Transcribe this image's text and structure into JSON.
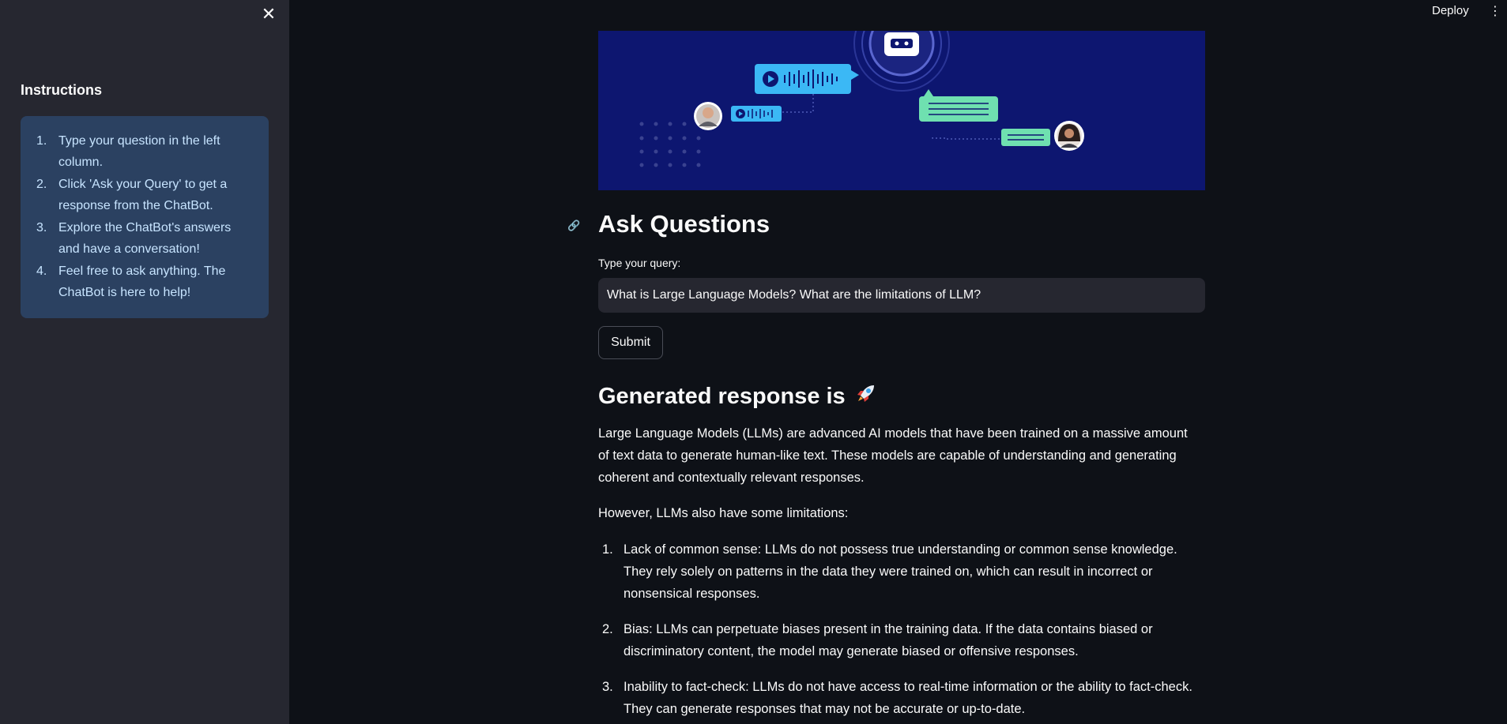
{
  "header": {
    "deploy_label": "Deploy"
  },
  "sidebar": {
    "title": "Instructions",
    "items": [
      {
        "num": "1.",
        "text": "Type your question in the left column."
      },
      {
        "num": "2.",
        "text": "Click 'Ask your Query' to get a response from the ChatBot."
      },
      {
        "num": "3.",
        "text": "Explore the ChatBot's answers and have a conversation!"
      },
      {
        "num": "4.",
        "text": "Feel free to ask anything. The ChatBot is here to help!"
      }
    ]
  },
  "main": {
    "ask_heading": "Ask Questions",
    "query_label": "Type your query:",
    "query_value": "What is Large Language Models? What are the limitations of LLM?",
    "submit_label": "Submit",
    "response_heading": "Generated response is",
    "response_paragraph_1": "Large Language Models (LLMs) are advanced AI models that have been trained on a massive amount of text data to generate human-like text. These models are capable of understanding and generating coherent and contextually relevant responses.",
    "response_paragraph_2": "However, LLMs also have some limitations:",
    "limitations": [
      {
        "num": "1.",
        "text": "Lack of common sense: LLMs do not possess true understanding or common sense knowledge. They rely solely on patterns in the data they were trained on, which can result in incorrect or nonsensical responses."
      },
      {
        "num": "2.",
        "text": "Bias: LLMs can perpetuate biases present in the training data. If the data contains biased or discriminatory content, the model may generate biased or offensive responses."
      },
      {
        "num": "3.",
        "text": "Inability to fact-check: LLMs do not have access to real-time information or the ability to fact-check. They can generate responses that may not be accurate or up-to-date."
      }
    ]
  },
  "colors": {
    "background": "#0e1117",
    "sidebar": "#262730",
    "info_box": "#2b4161",
    "banner": "#0d1670"
  }
}
